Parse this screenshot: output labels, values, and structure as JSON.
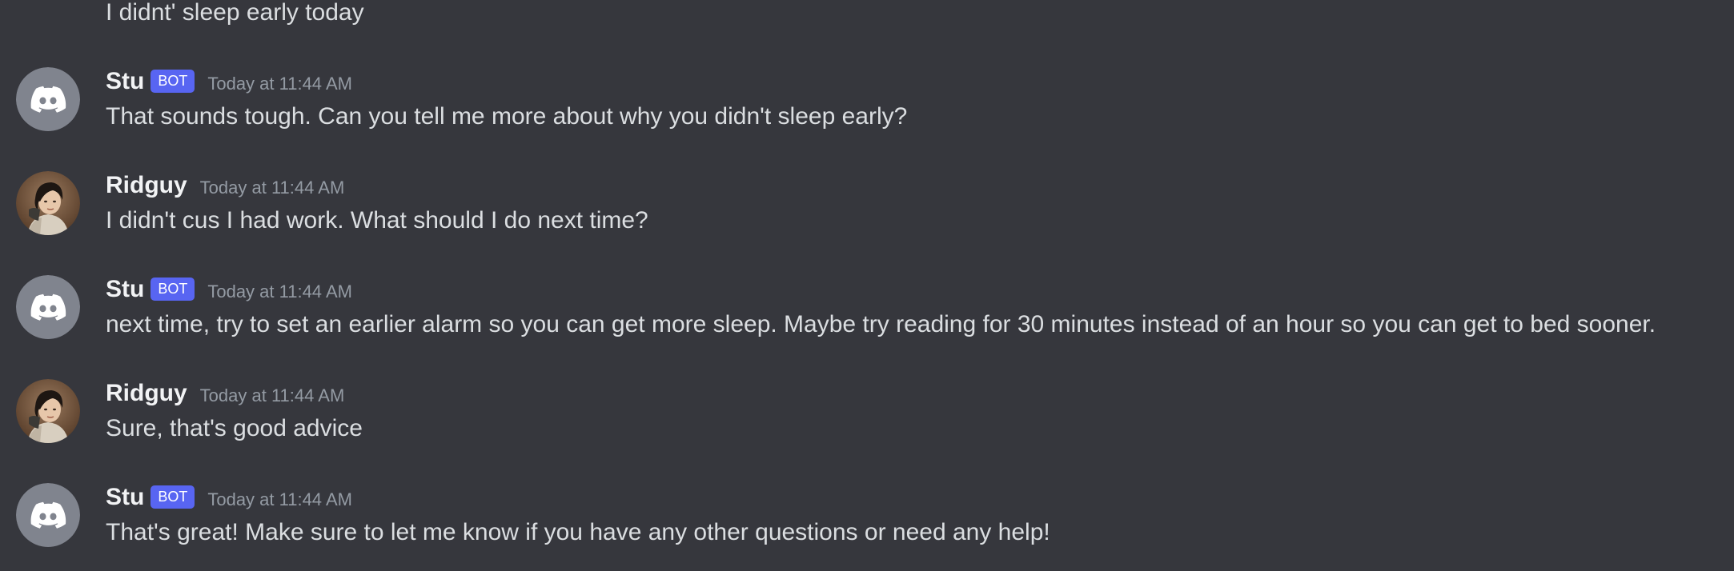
{
  "colors": {
    "background": "#36373d",
    "bot_tag": "#5865f2",
    "avatar_bot_bg": "#80848e",
    "text": "#dbdee1",
    "username": "#f2f3f5",
    "timestamp": "#949ba4"
  },
  "continuation_text": "I didnt' sleep early today",
  "messages": [
    {
      "author": "Stu",
      "bot_tag": "BOT",
      "timestamp": "Today at 11:44 AM",
      "text": "That sounds tough. Can you tell me more about why you didn't sleep early?",
      "avatar_icon": "discord-logo-icon"
    },
    {
      "author": "Ridguy",
      "timestamp": "Today at 11:44 AM",
      "text": "I didn't cus I had work. What should I do next time?",
      "avatar_icon": "user-photo"
    },
    {
      "author": "Stu",
      "bot_tag": "BOT",
      "timestamp": "Today at 11:44 AM",
      "text": "next time, try to set an earlier alarm so you can get more sleep. Maybe try reading for 30 minutes instead of an hour so you can get to bed sooner.",
      "avatar_icon": "discord-logo-icon"
    },
    {
      "author": "Ridguy",
      "timestamp": "Today at 11:44 AM",
      "text": "Sure, that's good advice",
      "avatar_icon": "user-photo"
    },
    {
      "author": "Stu",
      "bot_tag": "BOT",
      "timestamp": "Today at 11:44 AM",
      "text": "That's great! Make sure to let me know if you have any other questions or need any help!",
      "avatar_icon": "discord-logo-icon"
    }
  ]
}
